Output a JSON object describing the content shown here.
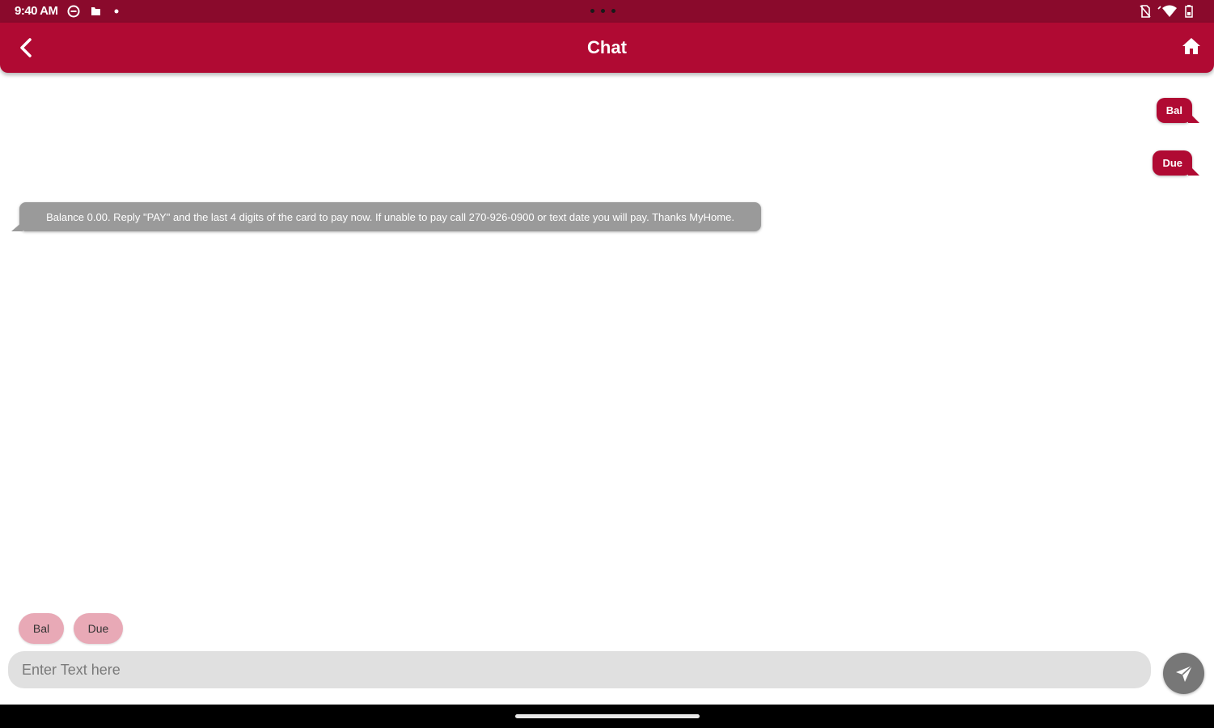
{
  "status_bar": {
    "time": "9:40 AM",
    "icons": [
      "vpn-icon",
      "sd-card-icon",
      "notification-dot-icon",
      "no-sim-icon",
      "wifi-icon",
      "battery-icon"
    ]
  },
  "app_bar": {
    "title": "Chat",
    "back_icon": "chevron-left-icon",
    "home_icon": "home-icon"
  },
  "messages": [
    {
      "direction": "outgoing",
      "text": "Bal"
    },
    {
      "direction": "outgoing",
      "text": "Due"
    },
    {
      "direction": "incoming",
      "text": "Balance 0.00. Reply \"PAY\" and the last 4 digits of the card to pay now. If unable to pay call 270-926-0900 or text date you will pay. Thanks MyHome."
    }
  ],
  "quick_replies": [
    "Bal",
    "Due"
  ],
  "composer": {
    "placeholder": "Enter Text here",
    "send_icon": "send-icon"
  },
  "colors": {
    "status_bar": "#8a0a2c",
    "app_bar": "#b00a33",
    "outgoing_bubble": "#b00a33",
    "incoming_bubble": "#9a9a9a",
    "chip": "#e8a9b6",
    "input_bg": "#e0e0e0",
    "send_button": "#777777"
  }
}
